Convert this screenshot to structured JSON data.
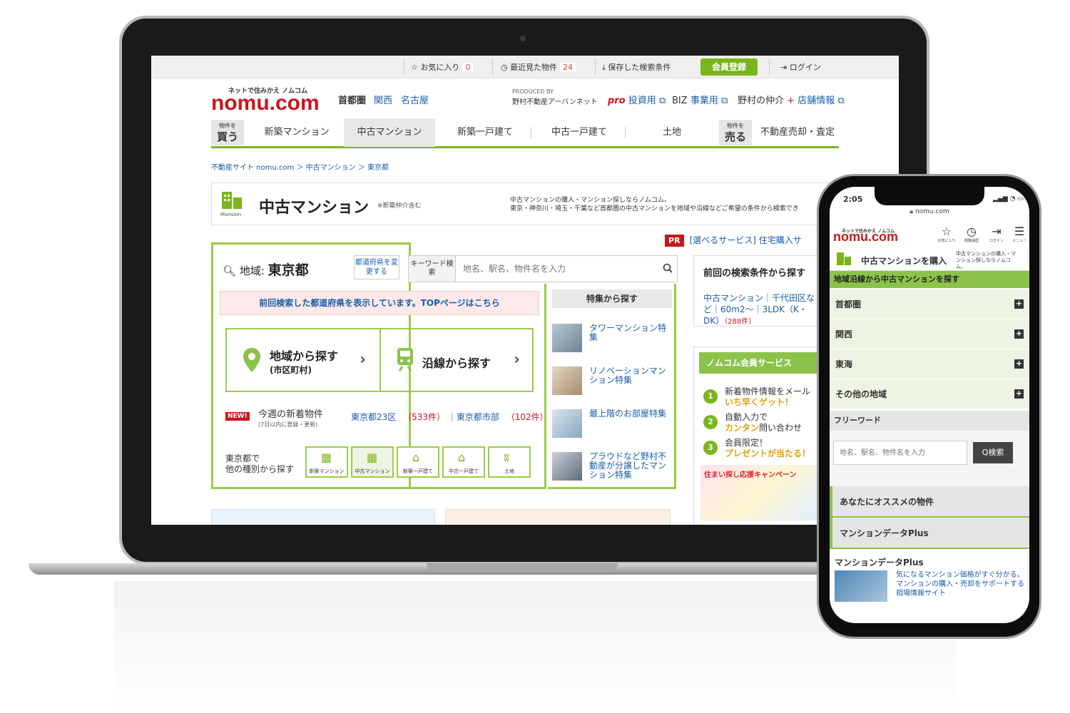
{
  "topbar": {
    "favorites": "お気に入り",
    "favorites_count": "0",
    "recent": "最近見た物件",
    "recent_count": "24",
    "saved": "保存した検索条件",
    "register": "会員登録",
    "login": "ログイン"
  },
  "header": {
    "tagline": "ネットで住みかえ ノムコム",
    "logo": "nomu.com",
    "regions": [
      "首都圏",
      "関西",
      "名古屋"
    ],
    "produced_by": "PRODUCED BY",
    "producer": "野村不動産アーバンネット",
    "pro_tag": "pro",
    "pro_label": "投資用",
    "biz_tag": "BIZ",
    "biz_label": "事業用",
    "broker_label": "野村の仲介",
    "shop_label": "店舗情報"
  },
  "nav": {
    "buy_small": "物件を",
    "buy_big": "買う",
    "items": [
      "新築マンション",
      "中古マンション",
      "新築一戸建て",
      "中古一戸建て",
      "土地"
    ],
    "sell_small": "物件を",
    "sell_big": "売る",
    "sell_item": "不動産売却・査定"
  },
  "breadcrumb": "不動産サイト nomu.com ＞ 中古マンション ＞ 東京都",
  "title": {
    "icon_label": "Mansion",
    "text": "中古マンション",
    "note": "※新築仲介含む",
    "desc1": "中古マンションの購入・マンション探しならノムコム。",
    "desc2": "東京・神奈川・埼玉・千葉など首都圏の中古マンションを地域や沿線などご希望の条件から検索でき"
  },
  "pr": {
    "badge": "PR",
    "text": "[選べるサービス] 住宅購入サ"
  },
  "search": {
    "area_prefix": "地域:",
    "area": "東京都",
    "change_btn": "都道府県を変更する",
    "kw_label": "キーワード検索",
    "kw_placeholder": "地名、駅名、物件名を入力",
    "notice": "前回検索した都道府県を表示しています。TOPページはこちら",
    "by_area": "地域から探す",
    "by_area_sub": "(市区町村)",
    "by_line": "沿線から探す",
    "new_badge": "NEW!",
    "new_title": "今週の新着物件",
    "new_sub": "(7日以内に登録・更新)",
    "new_link1": "東京都23区",
    "new_count1": "533件",
    "new_link2": "東京都市部",
    "new_count2": "102件",
    "types_label1": "東京都で",
    "types_label2": "他の種別から探す",
    "types": [
      "新築マンション",
      "中古マンション",
      "新築一戸建て",
      "中古一戸建て",
      "土地"
    ]
  },
  "features": {
    "head": "特集から探す",
    "items": [
      "タワーマンション特集",
      "リノベーションマンション特集",
      "最上階のお部屋特集",
      "プラウドなど野村不動産が分譲したマンション特集"
    ]
  },
  "previous": {
    "title": "前回の検索条件から探す",
    "body": "中古マンション｜千代田区など｜60m2〜｜3LDK（K・DK）",
    "count": "（288件）"
  },
  "member": {
    "head": "ノムコム会員サービス",
    "items": [
      {
        "num": "1",
        "text": "新着物件情報をメール",
        "hl": "いち早くゲット！"
      },
      {
        "num": "2",
        "text": "自動入力で",
        "hl": "カンタン",
        "text2": "問い合わせ"
      },
      {
        "num": "3",
        "text": "会員限定！",
        "hl": "プレゼントが当たる！"
      }
    ],
    "campaign": "住まい探し応援キャンペーン"
  },
  "phone": {
    "time": "2:05",
    "url": "nomu.com",
    "tagline": "ネットで住みかえ ノムコム",
    "logo": "nomu.com",
    "icons": [
      "お気に入り",
      "閲覧履歴",
      "ログイン",
      "メニュー"
    ],
    "head_title": "中古マンションを購入",
    "head_desc": "中古マンションの購入・マンション探しならノムコム。",
    "bar": "地域沿線から中古マンションを探す",
    "regions": [
      "首都圏",
      "関西",
      "東海",
      "その他の地域"
    ],
    "free_label": "フリーワード",
    "free_placeholder": "地名、駅名、物件名を入力",
    "search_btn": "Q検索",
    "sec1": "あなたにオススメの物件",
    "sec2": "マンションデータPlus",
    "foot_title": "マンションデータPlus",
    "foot_desc": "気になるマンション価格がすぐ分かる。マンションの購入・売却をサポートする相場情報サイト"
  },
  "colors": {
    "brand_red": "#c8161d",
    "accent_green": "#7ab51d",
    "link_blue": "#1a5ea8"
  }
}
